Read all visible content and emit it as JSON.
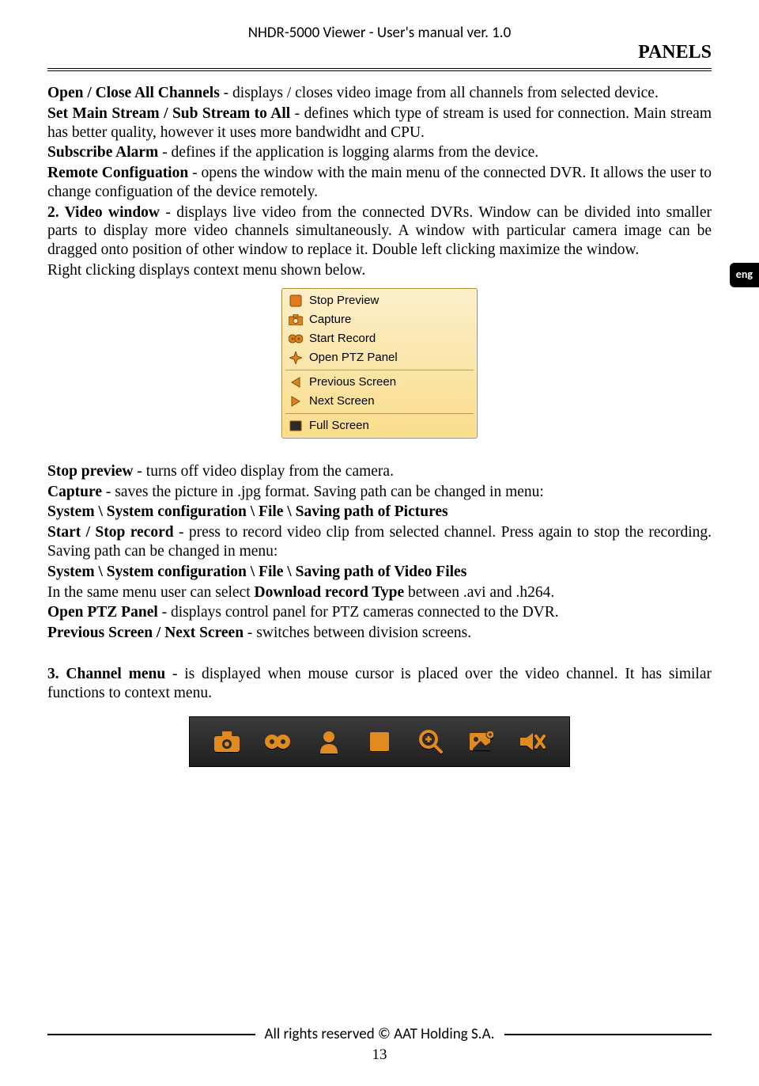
{
  "header": {
    "title": "NHDR-5000 Viewer - User's manual ver. 1.0"
  },
  "section_title": "PANELS",
  "lang_tab": "eng",
  "intro": {
    "openClose": {
      "bold": "Open / Close All Channels",
      "rest": " - displays / closes video image from all channels from selected device."
    },
    "setStream": {
      "bold": "Set Main Stream / Sub Stream to All",
      "rest": " - defines which type of stream is used for connection. Main stream has better quality, however it uses more bandwidht and CPU."
    },
    "subscribe": {
      "bold": "Subscribe Alarm",
      "rest": " - defines if the application is logging alarms from the device."
    },
    "remote": {
      "bold": "Remote Configuation",
      "rest": " - opens the window with the main menu of the connected DVR. It allows the user to change configuation of the device remotely."
    },
    "videoWindow": {
      "bold": "2. Video window",
      "rest": " - displays live video from the connected DVRs. Window can be divided into smaller parts to display more video channels simultaneously. A window with particular camera image can be dragged onto position of other window to replace it. Double left clicking maximize the window."
    },
    "rightClick": "Right clicking displays context menu shown below."
  },
  "context_menu": {
    "items": [
      {
        "label": "Stop Preview",
        "icon": "stop"
      },
      {
        "label": "Capture",
        "icon": "camera"
      },
      {
        "label": "Start Record",
        "icon": "record"
      },
      {
        "label": "Open PTZ Panel",
        "icon": "ptz"
      }
    ],
    "items2": [
      {
        "label": "Previous Screen",
        "icon": "prev"
      },
      {
        "label": "Next Screen",
        "icon": "next"
      }
    ],
    "items3": [
      {
        "label": "Full Screen",
        "icon": "fullscreen"
      }
    ]
  },
  "descriptions": {
    "stopPreview": {
      "bold": "Stop preview",
      "rest": " - turns off video display from the camera."
    },
    "capture": {
      "bold": "Capture",
      "rest": " - saves the picture in .jpg format. Saving path can be changed in menu:"
    },
    "capturePath": "System \\ System configuration \\ File \\ Saving path of Pictures",
    "startStop": {
      "bold": "Start / Stop record",
      "rest": " - press to record video clip from selected channel. Press again to stop the recording. Saving path can be changed in menu:"
    },
    "videoPath": "System \\ System configuration \\ File \\ Saving path of Video Files",
    "downloadType_pre": "In the same menu user can select ",
    "downloadType_bold": "Download record Type",
    "downloadType_post": " between .avi and .h264.",
    "openPTZ": {
      "bold": "Open PTZ Panel",
      "rest": " - displays control panel for PTZ cameras connected to the DVR."
    },
    "prevNext": {
      "bold": "Previous Screen / Next Screen",
      "rest": " - switches between division screens."
    }
  },
  "channelMenu": {
    "bold": "3. Channel menu",
    "rest": " - is displayed when mouse cursor is placed over the video channel. It has similar functions to context menu."
  },
  "footer": {
    "text": "All rights reserved © AAT Holding S.A.",
    "page": "13"
  }
}
